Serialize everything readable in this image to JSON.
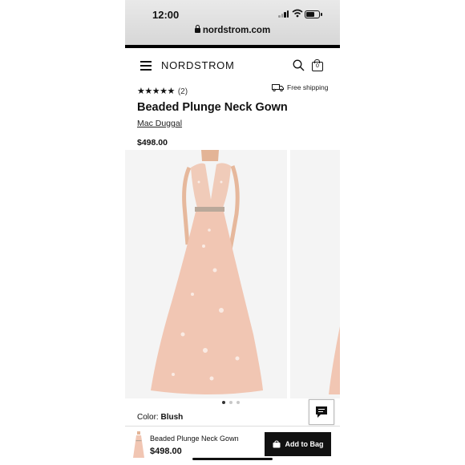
{
  "status_bar": {
    "time": "12:00"
  },
  "browser": {
    "url": "nordstrom.com"
  },
  "header": {
    "logo": "NORDSTROM",
    "bag_count": "0"
  },
  "product": {
    "stars": "★★★★★",
    "review_count": "(2)",
    "shipping": "Free shipping",
    "title": "Beaded Plunge Neck Gown",
    "brand": "Mac Duggal",
    "price": "$498.00",
    "color_label": "Color:",
    "color_value": "Blush"
  },
  "gallery": {
    "image_count": 3,
    "active_index": 0
  },
  "sticky_footer": {
    "title": "Beaded Plunge Neck Gown",
    "price": "$498.00",
    "add_button": "Add to Bag"
  },
  "colors": {
    "gown": "#f1c6b3",
    "background": "#f4f4f4",
    "dark": "#111111"
  }
}
